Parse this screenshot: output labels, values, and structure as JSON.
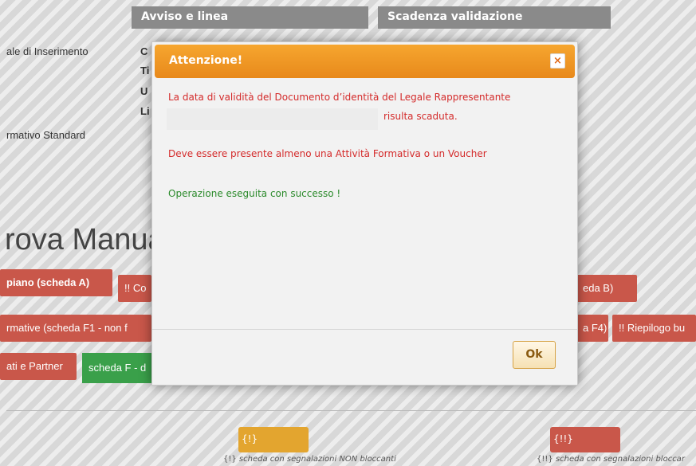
{
  "background": {
    "tabs": [
      "Avviso e linea",
      "Scadenza validazione"
    ],
    "left_labels": [
      "ale di Inserimento",
      "rmativo Standard"
    ],
    "field_initials": [
      "C",
      "Ti",
      "U",
      "Li"
    ],
    "page_title": "rova Manua",
    "row1": [
      "piano (scheda A)",
      "!! Co",
      "eda B)"
    ],
    "row2": [
      "rmative (scheda F1 - non f",
      "a F4)",
      "!! Riepilogo bu"
    ],
    "row3": [
      "ati e Partner",
      "scheda F - d"
    ],
    "legend": [
      {
        "badge": "{!}",
        "text_prefix": "{!}",
        "text": "scheda con segnalazioni NON bloccanti",
        "color": "#e3a52f"
      },
      {
        "badge": "{!!}",
        "text_prefix": "{!!}",
        "text": "scheda con segnalazioni bloccar",
        "color": "#c9574a"
      }
    ]
  },
  "modal": {
    "title": "Attenzione!",
    "close_symbol": "×",
    "message_line1": "La data di validità del Documento d’identità del Legale Rappresentante",
    "message_line2": "risulta scaduta.",
    "message_activity": "Deve essere presente almeno una Attività Formativa o un Voucher",
    "message_success": "Operazione eseguita con successo !",
    "ok_label": "Ok"
  },
  "colors": {
    "header_orange": "#f0971f",
    "error_red": "#d42b2b",
    "success_green": "#2b8a2b",
    "button_red": "#c9574a",
    "button_green": "#3aa04a"
  }
}
